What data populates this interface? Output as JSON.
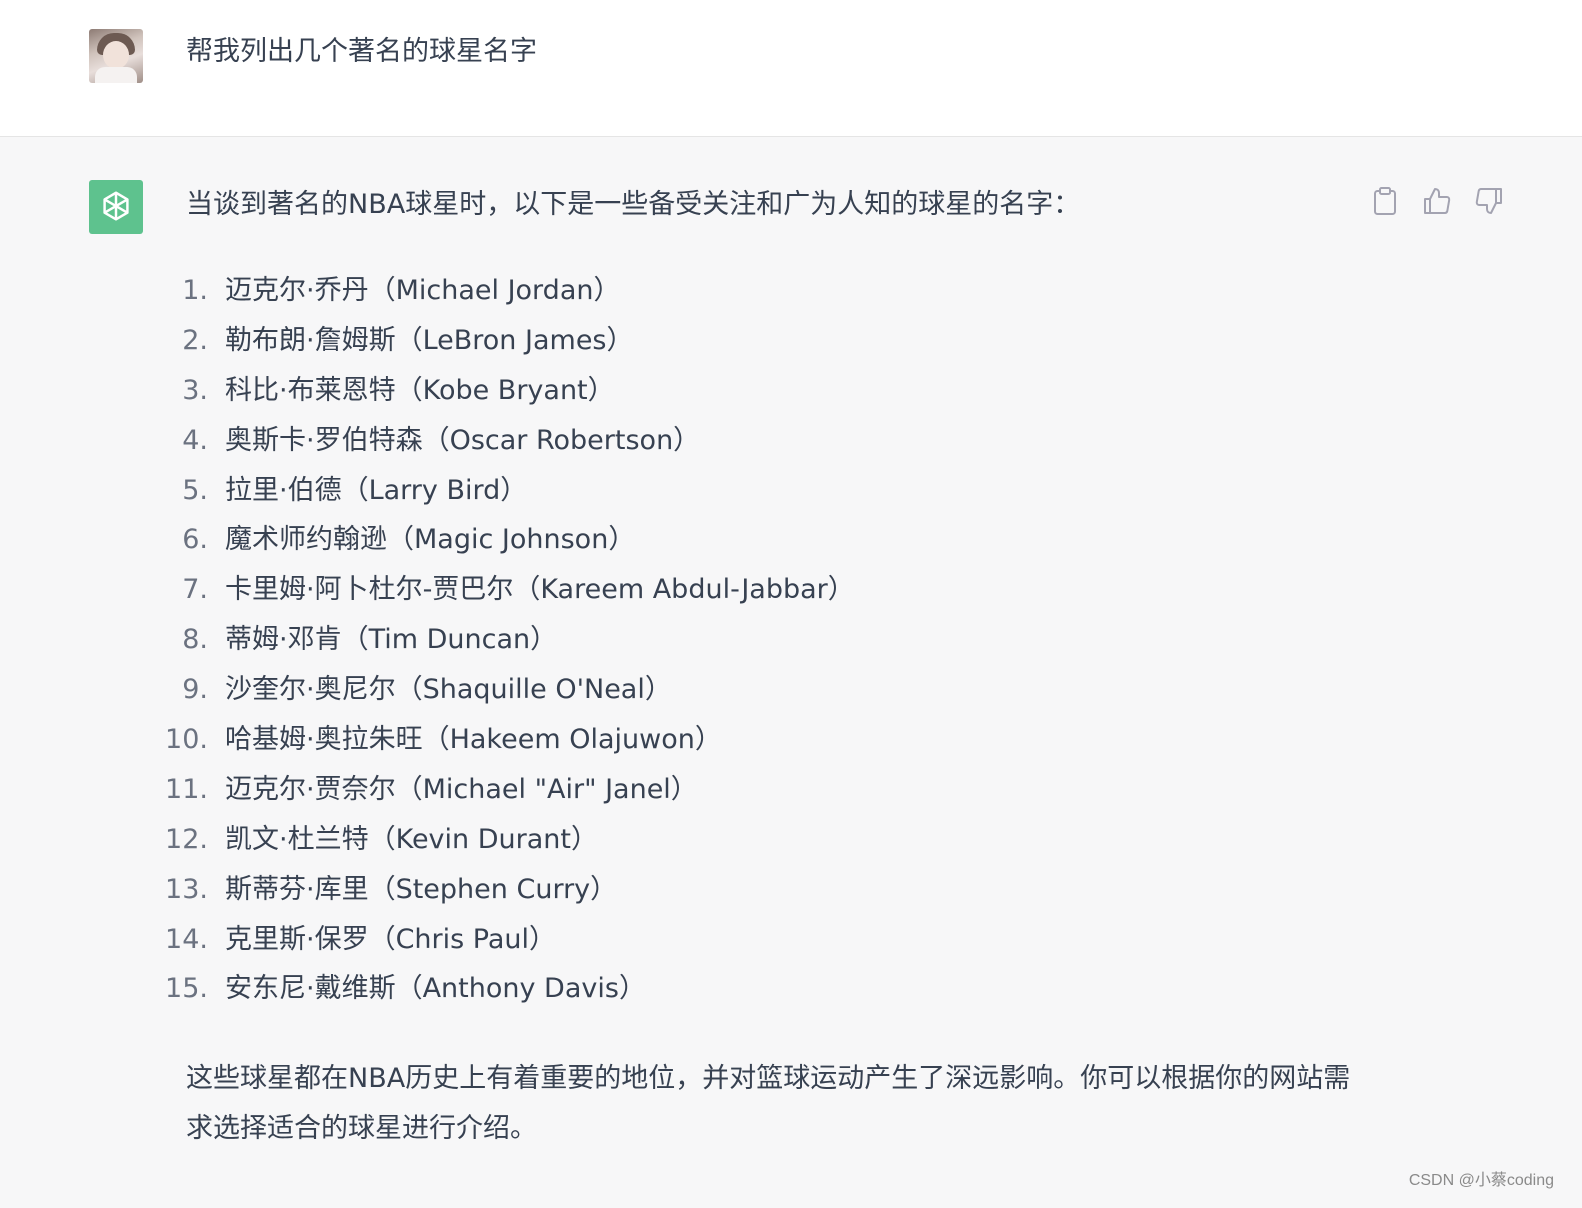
{
  "user_message": {
    "text": "帮我列出几个著名的球星名字"
  },
  "assistant_message": {
    "intro": "当谈到著名的NBA球星时，以下是一些备受关注和广为人知的球星的名字：",
    "players": [
      {
        "num": "1.",
        "name": "迈克尔·乔丹（Michael Jordan）"
      },
      {
        "num": "2.",
        "name": "勒布朗·詹姆斯（LeBron James）"
      },
      {
        "num": "3.",
        "name": "科比·布莱恩特（Kobe Bryant）"
      },
      {
        "num": "4.",
        "name": "奥斯卡·罗伯特森（Oscar Robertson）"
      },
      {
        "num": "5.",
        "name": "拉里·伯德（Larry Bird）"
      },
      {
        "num": "6.",
        "name": "魔术师约翰逊（Magic Johnson）"
      },
      {
        "num": "7.",
        "name": "卡里姆·阿卜杜尔-贾巴尔（Kareem Abdul-Jabbar）"
      },
      {
        "num": "8.",
        "name": "蒂姆·邓肯（Tim Duncan）"
      },
      {
        "num": "9.",
        "name": "沙奎尔·奥尼尔（Shaquille O'Neal）"
      },
      {
        "num": "10.",
        "name": "哈基姆·奥拉朱旺（Hakeem Olajuwon）"
      },
      {
        "num": "11.",
        "name": "迈克尔·贾奈尔（Michael \"Air\" Janel）"
      },
      {
        "num": "12.",
        "name": "凯文·杜兰特（Kevin Durant）"
      },
      {
        "num": "13.",
        "name": "斯蒂芬·库里（Stephen Curry）"
      },
      {
        "num": "14.",
        "name": "克里斯·保罗（Chris Paul）"
      },
      {
        "num": "15.",
        "name": "安东尼·戴维斯（Anthony Davis）"
      }
    ],
    "outro": "这些球星都在NBA历史上有着重要的地位，并对篮球运动产生了深远影响。你可以根据你的网站需求选择适合的球星进行介绍。"
  },
  "icons": {
    "copy": "clipboard-icon",
    "like": "thumbs-up-icon",
    "dislike": "thumbs-down-icon",
    "assistant_logo": "openai-logo-icon"
  },
  "colors": {
    "assistant_bg": "#f7f7f8",
    "user_bg": "#ffffff",
    "logo_bg": "#5ec28e",
    "text": "#374151",
    "icon": "#a3a3b1"
  },
  "watermark": "CSDN @小蔡coding"
}
